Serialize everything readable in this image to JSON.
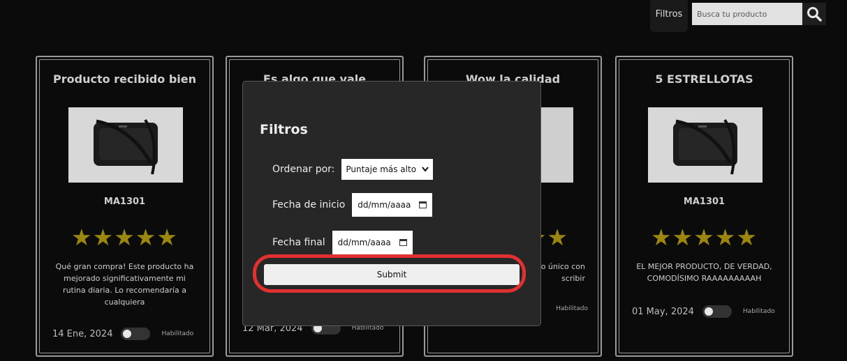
{
  "header": {
    "filtros_label": "Filtros",
    "search_placeholder": "Busca tu producto",
    "search_icon": "search-icon"
  },
  "cards": [
    {
      "title": "Producto recibido bien",
      "code": "MA1301",
      "stars": "★★★★★",
      "text": "Qué gran compra! Este producto ha mejorado significativamente mi rutina diaria. Lo recomendaría a cualquiera",
      "date": "14 Ene, 2024",
      "status": "Habilitado"
    },
    {
      "title": "Es algo que vale",
      "code": "",
      "stars": "",
      "text": "",
      "date": "12 Mar, 2024",
      "status": "Habilitado"
    },
    {
      "title": "Wow la calidad",
      "code": "",
      "stars": "★★",
      "text": "o único con\nscribir",
      "date": "",
      "status": "Habilitado"
    },
    {
      "title": "5 ESTRELLOTAS",
      "code": "MA1301",
      "stars": "★★★★★",
      "text": "EL MEJOR PRODUCTO, DE VERDAD, COMODÍSIMO RAAAAAAAAAH",
      "date": "01 May, 2024",
      "status": "Habilitado"
    }
  ],
  "modal": {
    "title": "Filtros",
    "order_label": "Ordenar por:",
    "order_value": "Puntaje más alto",
    "start_label": "Fecha de inicio",
    "start_value": "dd/mm/aaaa",
    "end_label": "Fecha final",
    "end_value": "dd/mm/aaaa",
    "submit_label": "Submit"
  },
  "colors": {
    "star": "#9b8710",
    "highlight": "#e03030"
  }
}
